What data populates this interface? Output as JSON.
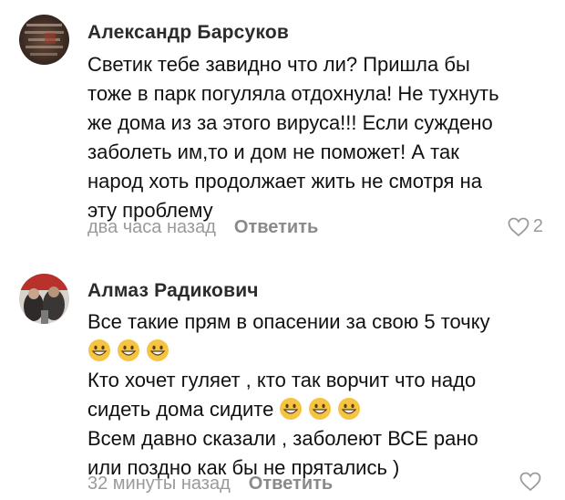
{
  "comments": [
    {
      "author": "Александр Барсуков",
      "lines": [
        "Светик тебе завидно что ли? Пришла бы",
        "тоже в парк погуляла отдохнула! Не тухнуть",
        "же дома из за этого вируса!!! Если суждено",
        "заболеть им,то и дом не поможет! А так",
        "народ хоть продолжает жить не смотря на",
        "эту проблему"
      ],
      "time": "два часа назад",
      "reply_label": "Ответить",
      "likes": "2"
    },
    {
      "author": "Алмаз Радикович",
      "line1": "Все такие прям в опасении за свою 5 точку",
      "line3": "Кто хочет гуляет , кто так ворчит что надо",
      "line4_text": "сидеть дома сидите",
      "line5": "Всем давно сказали , заболеют ВСЕ рано",
      "line6": "или поздно как бы не прятались )",
      "time": "32 минуты назад",
      "reply_label": "Ответить",
      "likes": ""
    }
  ],
  "icons": {
    "like": "heart-outline-icon",
    "emoji": "grinning-face-icon"
  },
  "colors": {
    "meta": "#9a9a9a",
    "reply": "#8a8a8a",
    "emoji_face": "#f5c542"
  }
}
